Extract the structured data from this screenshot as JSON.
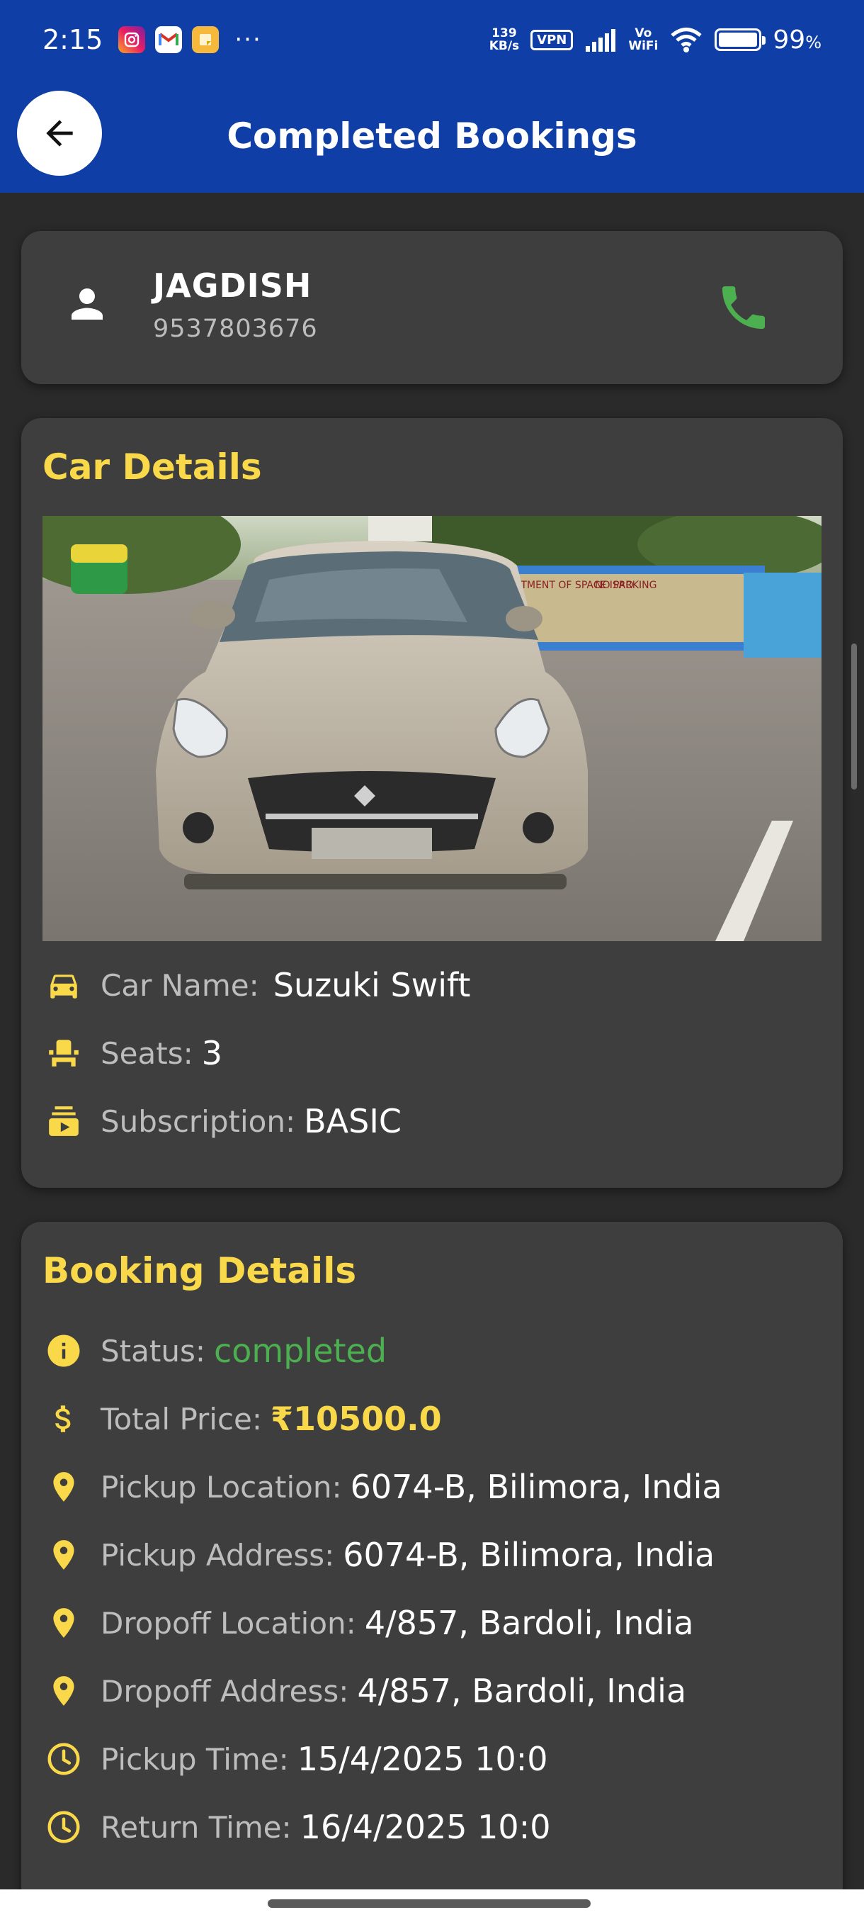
{
  "status_bar": {
    "time": "2:15",
    "more": "···",
    "net_speed_value": "139",
    "net_speed_unit": "KB/s",
    "vpn": "VPN",
    "vo": "Vo",
    "wifi_label": "WiFi",
    "battery": "99",
    "battery_unit": "%"
  },
  "header": {
    "title": "Completed Bookings"
  },
  "user": {
    "name": "JAGDISH",
    "phone": "9537803676"
  },
  "car": {
    "section_title": "Car Details",
    "name_label": "Car Name:",
    "name_value": "Suzuki Swift",
    "seats_label": "Seats:",
    "seats_value": "3",
    "subscription_label": "Subscription:",
    "subscription_value": "BASIC",
    "photo_sign_1": "DEPARTMENT OF SPACE ISRO",
    "photo_sign_2": "NO PARKING"
  },
  "booking": {
    "section_title": "Booking Details",
    "status_label": "Status:",
    "status_value": "completed",
    "price_label": "Total Price:",
    "price_value": "₹10500.0",
    "pickup_location_label": "Pickup Location:",
    "pickup_location_value": "6074-B, Bilimora, India",
    "pickup_address_label": "Pickup Address:",
    "pickup_address_value": "6074-B, Bilimora, India",
    "dropoff_location_label": "Dropoff Location:",
    "dropoff_location_value": "4/857, Bardoli, India",
    "dropoff_address_label": "Dropoff Address:",
    "dropoff_address_value": "4/857, Bardoli, India",
    "pickup_time_label": "Pickup Time:",
    "pickup_time_value": "15/4/2025 10:0",
    "return_time_label": "Return Time:",
    "return_time_value": "16/4/2025 10:0"
  },
  "colors": {
    "app_bar": "#0f3fa6",
    "accent_yellow": "#f9d949",
    "status_green": "#4caf50",
    "card": "#3e3e3e"
  }
}
